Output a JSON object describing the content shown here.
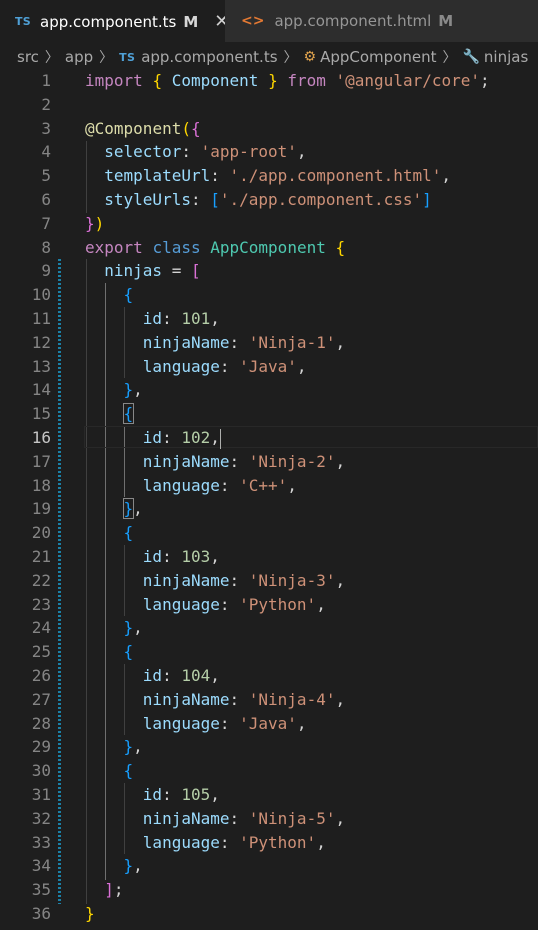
{
  "tabs": [
    {
      "badge": "TS",
      "label": "app.component.ts",
      "modified": "M",
      "close": "✕",
      "active": true
    },
    {
      "badge": "<>",
      "label": "app.component.html",
      "modified": "M",
      "active": false
    }
  ],
  "breadcrumb": {
    "parts": [
      "src",
      "app",
      "app.component.ts",
      "AppComponent",
      "ninjas"
    ],
    "ts_badge": "TS"
  },
  "editor": {
    "current_line": 16,
    "lines": [
      {
        "n": "1",
        "tokens": [
          [
            "t-kw",
            "import"
          ],
          [
            "t-p",
            " "
          ],
          [
            "t-b1",
            "{"
          ],
          [
            "t-p",
            " "
          ],
          [
            "t-prop",
            "Component"
          ],
          [
            "t-p",
            " "
          ],
          [
            "t-b1",
            "}"
          ],
          [
            "t-p",
            " "
          ],
          [
            "t-kw",
            "from"
          ],
          [
            "t-p",
            " "
          ],
          [
            "t-str",
            "'@angular/core'"
          ],
          [
            "t-p",
            ";"
          ]
        ]
      },
      {
        "n": "2",
        "tokens": []
      },
      {
        "n": "3",
        "tokens": [
          [
            "t-dec",
            "@"
          ],
          [
            "t-dec",
            "Component"
          ],
          [
            "t-b1",
            "("
          ],
          [
            "t-b2",
            "{"
          ]
        ]
      },
      {
        "n": "4",
        "tokens": [
          [
            "t-p",
            "  "
          ],
          [
            "t-prop",
            "selector"
          ],
          [
            "t-p",
            ": "
          ],
          [
            "t-str",
            "'app-root'"
          ],
          [
            "t-p",
            ","
          ]
        ]
      },
      {
        "n": "5",
        "tokens": [
          [
            "t-p",
            "  "
          ],
          [
            "t-prop",
            "templateUrl"
          ],
          [
            "t-p",
            ": "
          ],
          [
            "t-str",
            "'./app.component.html'"
          ],
          [
            "t-p",
            ","
          ]
        ]
      },
      {
        "n": "6",
        "tokens": [
          [
            "t-p",
            "  "
          ],
          [
            "t-prop",
            "styleUrls"
          ],
          [
            "t-p",
            ": "
          ],
          [
            "t-b3",
            "["
          ],
          [
            "t-str",
            "'./app.component.css'"
          ],
          [
            "t-b3",
            "]"
          ]
        ]
      },
      {
        "n": "7",
        "tokens": [
          [
            "t-b2",
            "}"
          ],
          [
            "t-b1",
            ")"
          ]
        ]
      },
      {
        "n": "8",
        "tokens": [
          [
            "t-kw",
            "export"
          ],
          [
            "t-p",
            " "
          ],
          [
            "t-kw2",
            "class"
          ],
          [
            "t-p",
            " "
          ],
          [
            "t-cls",
            "AppComponent"
          ],
          [
            "t-p",
            " "
          ],
          [
            "t-b1",
            "{"
          ]
        ]
      },
      {
        "n": "9",
        "tokens": [
          [
            "t-p",
            "  "
          ],
          [
            "t-prop",
            "ninjas"
          ],
          [
            "t-p",
            " = "
          ],
          [
            "t-b2",
            "["
          ]
        ]
      },
      {
        "n": "10",
        "tokens": [
          [
            "t-p",
            "    "
          ],
          [
            "t-b3",
            "{"
          ]
        ]
      },
      {
        "n": "11",
        "tokens": [
          [
            "t-p",
            "      "
          ],
          [
            "t-prop",
            "id"
          ],
          [
            "t-p",
            ": "
          ],
          [
            "t-num",
            "101"
          ],
          [
            "t-p",
            ","
          ]
        ]
      },
      {
        "n": "12",
        "tokens": [
          [
            "t-p",
            "      "
          ],
          [
            "t-prop",
            "ninjaName"
          ],
          [
            "t-p",
            ": "
          ],
          [
            "t-str",
            "'Ninja-1'"
          ],
          [
            "t-p",
            ","
          ]
        ]
      },
      {
        "n": "13",
        "tokens": [
          [
            "t-p",
            "      "
          ],
          [
            "t-prop",
            "language"
          ],
          [
            "t-p",
            ": "
          ],
          [
            "t-str",
            "'Java'"
          ],
          [
            "t-p",
            ","
          ]
        ]
      },
      {
        "n": "14",
        "tokens": [
          [
            "t-p",
            "    "
          ],
          [
            "t-b3",
            "}"
          ],
          [
            "t-p",
            ","
          ]
        ]
      },
      {
        "n": "15",
        "tokens": [
          [
            "t-p",
            "    "
          ],
          [
            "t-b3 bm",
            "{"
          ]
        ]
      },
      {
        "n": "16",
        "tokens": [
          [
            "t-p",
            "      "
          ],
          [
            "t-prop",
            "id"
          ],
          [
            "t-p",
            ": "
          ],
          [
            "t-num",
            "102"
          ],
          [
            "t-p",
            ","
          ],
          [
            "caret",
            ""
          ]
        ]
      },
      {
        "n": "17",
        "tokens": [
          [
            "t-p",
            "      "
          ],
          [
            "t-prop",
            "ninjaName"
          ],
          [
            "t-p",
            ": "
          ],
          [
            "t-str",
            "'Ninja-2'"
          ],
          [
            "t-p",
            ","
          ]
        ]
      },
      {
        "n": "18",
        "tokens": [
          [
            "t-p",
            "      "
          ],
          [
            "t-prop",
            "language"
          ],
          [
            "t-p",
            ": "
          ],
          [
            "t-str",
            "'C++'"
          ],
          [
            "t-p",
            ","
          ]
        ]
      },
      {
        "n": "19",
        "tokens": [
          [
            "t-p",
            "    "
          ],
          [
            "t-b3 bm",
            "}"
          ],
          [
            "t-p",
            ","
          ]
        ]
      },
      {
        "n": "20",
        "tokens": [
          [
            "t-p",
            "    "
          ],
          [
            "t-b3",
            "{"
          ]
        ]
      },
      {
        "n": "21",
        "tokens": [
          [
            "t-p",
            "      "
          ],
          [
            "t-prop",
            "id"
          ],
          [
            "t-p",
            ": "
          ],
          [
            "t-num",
            "103"
          ],
          [
            "t-p",
            ","
          ]
        ]
      },
      {
        "n": "22",
        "tokens": [
          [
            "t-p",
            "      "
          ],
          [
            "t-prop",
            "ninjaName"
          ],
          [
            "t-p",
            ": "
          ],
          [
            "t-str",
            "'Ninja-3'"
          ],
          [
            "t-p",
            ","
          ]
        ]
      },
      {
        "n": "23",
        "tokens": [
          [
            "t-p",
            "      "
          ],
          [
            "t-prop",
            "language"
          ],
          [
            "t-p",
            ": "
          ],
          [
            "t-str",
            "'Python'"
          ],
          [
            "t-p",
            ","
          ]
        ]
      },
      {
        "n": "24",
        "tokens": [
          [
            "t-p",
            "    "
          ],
          [
            "t-b3",
            "}"
          ],
          [
            "t-p",
            ","
          ]
        ]
      },
      {
        "n": "25",
        "tokens": [
          [
            "t-p",
            "    "
          ],
          [
            "t-b3",
            "{"
          ]
        ]
      },
      {
        "n": "26",
        "tokens": [
          [
            "t-p",
            "      "
          ],
          [
            "t-prop",
            "id"
          ],
          [
            "t-p",
            ": "
          ],
          [
            "t-num",
            "104"
          ],
          [
            "t-p",
            ","
          ]
        ]
      },
      {
        "n": "27",
        "tokens": [
          [
            "t-p",
            "      "
          ],
          [
            "t-prop",
            "ninjaName"
          ],
          [
            "t-p",
            ": "
          ],
          [
            "t-str",
            "'Ninja-4'"
          ],
          [
            "t-p",
            ","
          ]
        ]
      },
      {
        "n": "28",
        "tokens": [
          [
            "t-p",
            "      "
          ],
          [
            "t-prop",
            "language"
          ],
          [
            "t-p",
            ": "
          ],
          [
            "t-str",
            "'Java'"
          ],
          [
            "t-p",
            ","
          ]
        ]
      },
      {
        "n": "29",
        "tokens": [
          [
            "t-p",
            "    "
          ],
          [
            "t-b3",
            "}"
          ],
          [
            "t-p",
            ","
          ]
        ]
      },
      {
        "n": "30",
        "tokens": [
          [
            "t-p",
            "    "
          ],
          [
            "t-b3",
            "{"
          ]
        ]
      },
      {
        "n": "31",
        "tokens": [
          [
            "t-p",
            "      "
          ],
          [
            "t-prop",
            "id"
          ],
          [
            "t-p",
            ": "
          ],
          [
            "t-num",
            "105"
          ],
          [
            "t-p",
            ","
          ]
        ]
      },
      {
        "n": "32",
        "tokens": [
          [
            "t-p",
            "      "
          ],
          [
            "t-prop",
            "ninjaName"
          ],
          [
            "t-p",
            ": "
          ],
          [
            "t-str",
            "'Ninja-5'"
          ],
          [
            "t-p",
            ","
          ]
        ]
      },
      {
        "n": "33",
        "tokens": [
          [
            "t-p",
            "      "
          ],
          [
            "t-prop",
            "language"
          ],
          [
            "t-p",
            ": "
          ],
          [
            "t-str",
            "'Python'"
          ],
          [
            "t-p",
            ","
          ]
        ]
      },
      {
        "n": "34",
        "tokens": [
          [
            "t-p",
            "    "
          ],
          [
            "t-b3",
            "}"
          ],
          [
            "t-p",
            ","
          ]
        ]
      },
      {
        "n": "35",
        "tokens": [
          [
            "t-p",
            "  "
          ],
          [
            "t-b2",
            "]"
          ],
          [
            "t-p",
            ";"
          ]
        ]
      },
      {
        "n": "36",
        "tokens": [
          [
            "t-b1",
            "}"
          ]
        ]
      }
    ]
  }
}
